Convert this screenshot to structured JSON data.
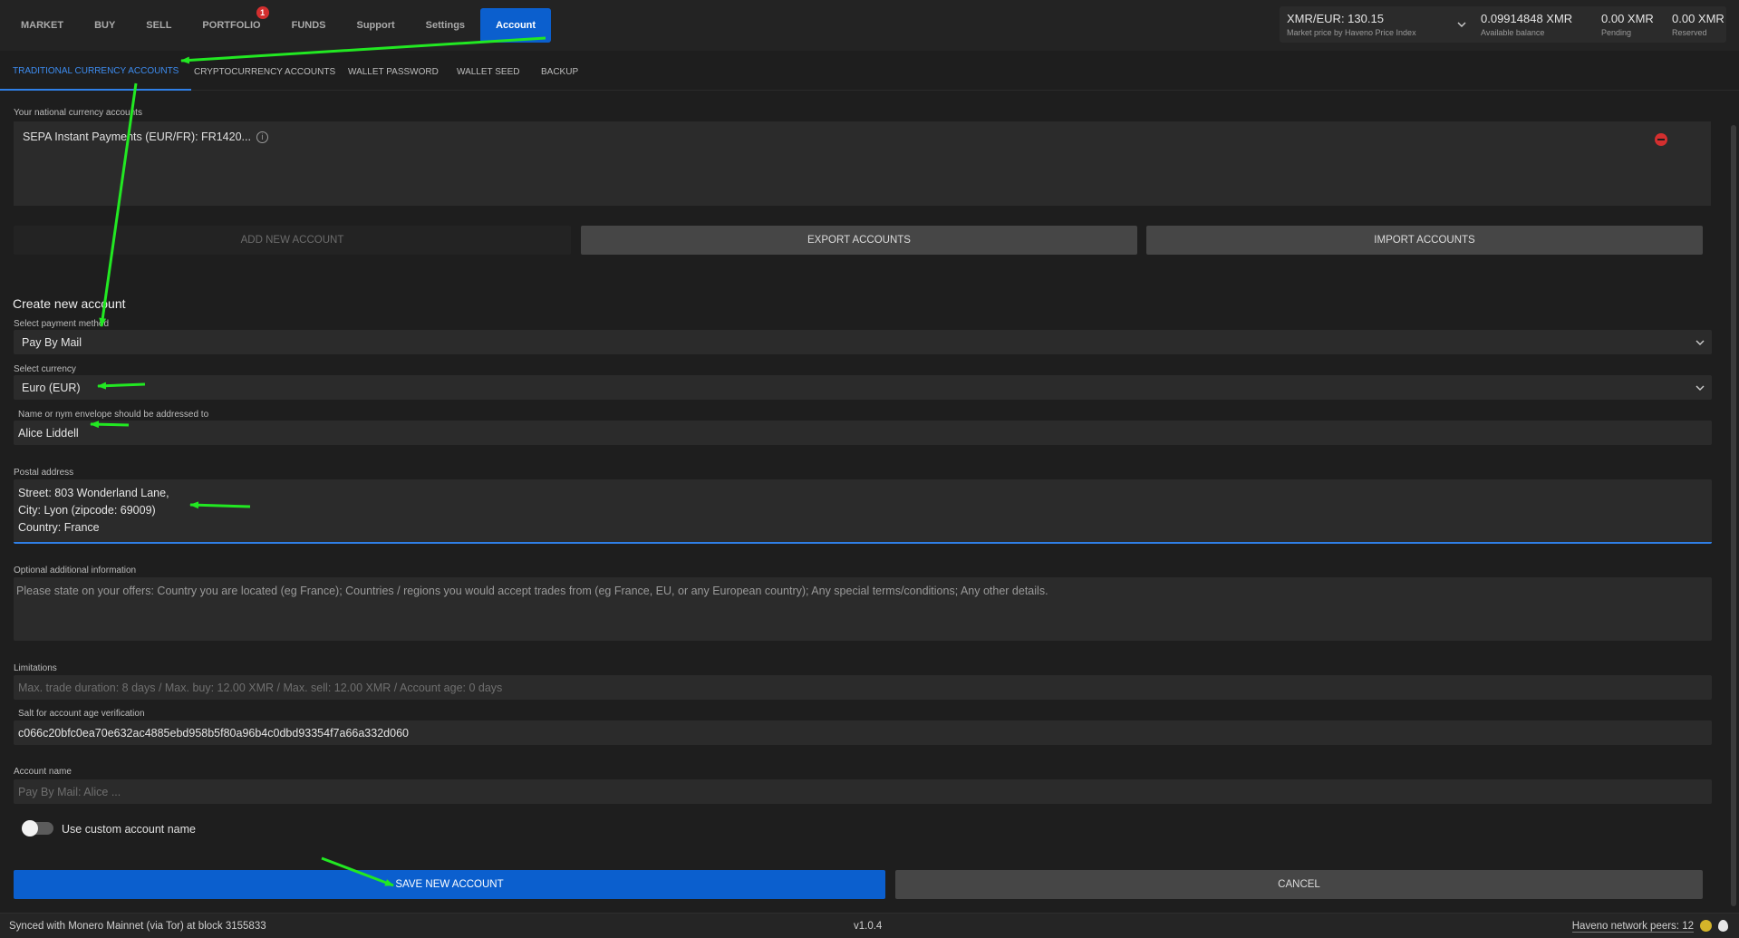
{
  "nav": {
    "items": [
      {
        "label": "MARKET",
        "name": "nav-market"
      },
      {
        "label": "BUY",
        "name": "nav-buy"
      },
      {
        "label": "SELL",
        "name": "nav-sell"
      },
      {
        "label": "PORTFOLIO",
        "name": "nav-portfolio",
        "badge": "1"
      },
      {
        "label": "FUNDS",
        "name": "nav-funds"
      },
      {
        "label": "Support",
        "name": "nav-support"
      },
      {
        "label": "Settings",
        "name": "nav-settings"
      },
      {
        "label": "Account",
        "name": "nav-account",
        "active": true
      }
    ]
  },
  "balances": {
    "price_value": "XMR/EUR: 130.15",
    "price_caption": "Market price by Haveno Price Index",
    "available_value": "0.09914848 XMR",
    "available_caption": "Available balance",
    "pending_value": "0.00 XMR",
    "pending_caption": "Pending",
    "reserved_value": "0.00 XMR",
    "reserved_caption": "Reserved"
  },
  "subtabs": {
    "traditional": "TRADITIONAL CURRENCY ACCOUNTS",
    "crypto": "CRYPTOCURRENCY ACCOUNTS",
    "wallet_password": "WALLET PASSWORD",
    "wallet_seed": "WALLET SEED",
    "backup": "BACKUP"
  },
  "accounts": {
    "label": "Your national currency accounts",
    "items": [
      "SEPA Instant Payments (EUR/FR): FR1420..."
    ],
    "add_button": "ADD NEW ACCOUNT",
    "export_button": "EXPORT ACCOUNTS",
    "import_button": "IMPORT ACCOUNTS"
  },
  "form": {
    "title": "Create new account",
    "payment_method_label": "Select payment method",
    "payment_method_value": "Pay By Mail",
    "currency_label": "Select currency",
    "currency_value": "Euro (EUR)",
    "contact_label": "Name or nym envelope should be addressed to",
    "contact_value": "Alice Liddell",
    "postal_label": "Postal address",
    "postal_lines": [
      "Street: 803 Wonderland Lane,",
      "City: Lyon (zipcode: 69009)",
      "Country: France"
    ],
    "extra_label": "Optional additional information",
    "extra_placeholder": "Please state on your offers: Country you are located (eg France); Countries / regions you would accept trades from (eg France, EU, or any European country); Any special terms/conditions; Any other details.",
    "limitations_label": "Limitations",
    "limitations_value": "Max. trade duration: 8 days / Max. buy: 12.00 XMR / Max. sell: 12.00 XMR / Account age: 0 days",
    "salt_label": "Salt for account age verification",
    "salt_value": "c066c20bfc0ea70e632ac4885ebd958b5f80a96b4c0dbd93354f7a66a332d060",
    "account_name_label": "Account name",
    "account_name_placeholder": "Pay By Mail: Alice ...",
    "custom_name_label": "Use custom account name",
    "save_button": "SAVE NEW ACCOUNT",
    "cancel_button": "CANCEL"
  },
  "footer": {
    "sync_status": "Synced with Monero Mainnet (via Tor) at block 3155833",
    "version": "v1.0.4",
    "peers": "Haveno network peers: 12"
  },
  "colors": {
    "accent": "#0b5fce",
    "annotation": "#22e822",
    "danger": "#d32f2f"
  }
}
